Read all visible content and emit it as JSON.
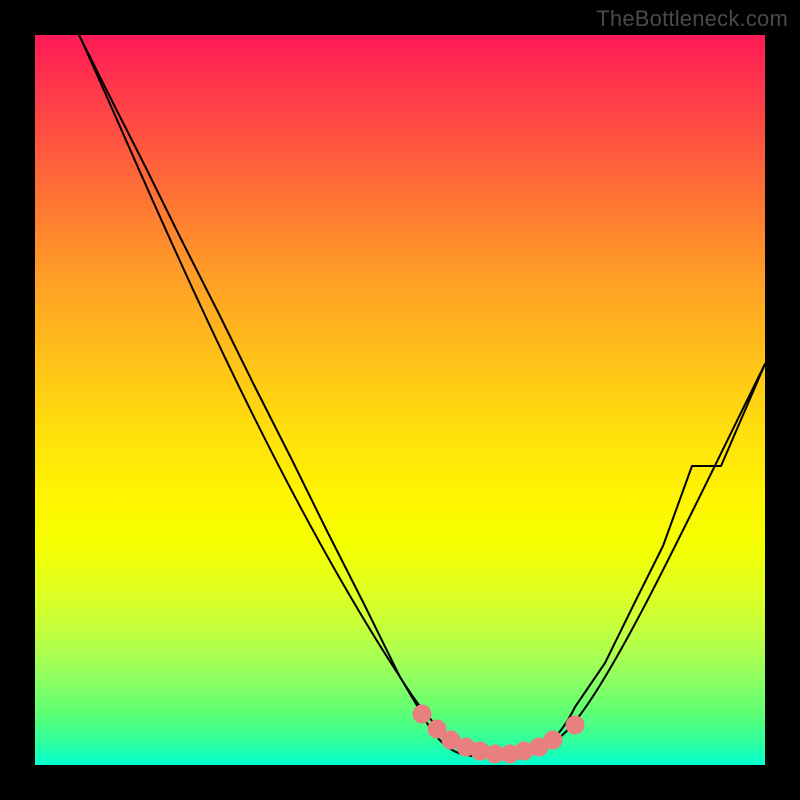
{
  "watermark": "TheBottleneck.com",
  "chart_data": {
    "type": "line",
    "title": "",
    "xlabel": "",
    "ylabel": "",
    "xlim": [
      0,
      100
    ],
    "ylim": [
      0,
      100
    ],
    "series": [
      {
        "name": "bottleneck-curve",
        "x": [
          6,
          10,
          15,
          20,
          25,
          30,
          35,
          40,
          45,
          50,
          53,
          56,
          59,
          62,
          65,
          68,
          71,
          74,
          78,
          82,
          86,
          90,
          94,
          100
        ],
        "values": [
          100,
          92,
          82,
          72,
          62,
          52,
          42,
          32,
          22,
          12,
          7,
          4,
          2,
          1,
          1,
          1.5,
          2,
          4,
          8,
          14,
          22,
          31,
          41,
          55
        ]
      },
      {
        "name": "highlight-dots",
        "x": [
          53,
          55,
          57,
          59,
          61,
          63,
          65,
          67,
          69,
          71,
          74
        ],
        "values": [
          7,
          5,
          3.5,
          2.5,
          2,
          1.5,
          1.5,
          2,
          2.5,
          3.5,
          5.5
        ]
      }
    ],
    "colors": {
      "curve": "#000000",
      "dots": "#e88080",
      "background_top": "#ff1a56",
      "background_bottom": "#00ffd0"
    }
  }
}
